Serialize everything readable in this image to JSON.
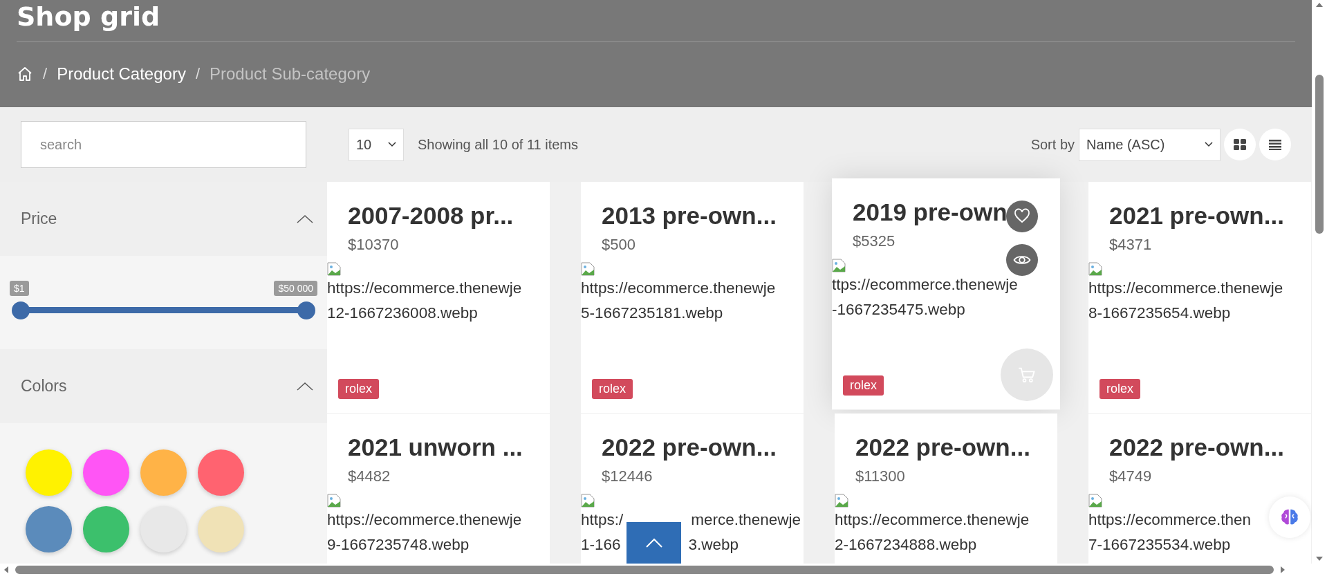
{
  "page_title": "Shop grid",
  "breadcrumb": [
    {
      "separator": "/",
      "label": "Product Category",
      "current": false
    },
    {
      "separator": "/",
      "label": "Product Sub-category",
      "current": true
    }
  ],
  "toolbar": {
    "search": {
      "placeholder": "search"
    },
    "per_page": "10",
    "result_count": "Showing all 10 of 11 items",
    "sort_label": "Sort by",
    "sort_value": "Name (ASC)",
    "views": [
      {
        "kind": "grid"
      },
      {
        "kind": "list"
      }
    ]
  },
  "filters": [
    {
      "kind": "price",
      "title": "Price",
      "expanded": true,
      "thumbs": [
        {
          "label": "$1",
          "level": 0
        },
        {
          "label": "$50 000",
          "level": 1
        }
      ]
    },
    {
      "kind": "colors",
      "title": "Colors",
      "expanded": true,
      "swatches": [
        {
          "color": "#fff200"
        },
        {
          "color": "#ff55f5"
        },
        {
          "color": "#ffb347"
        },
        {
          "color": "#ff6370"
        },
        {
          "color": "#5b8bbb"
        },
        {
          "color": "#3cc06c"
        },
        {
          "color": "#e8e8e8"
        },
        {
          "color": "#f0e2b6"
        }
      ]
    }
  ],
  "products": [
    {
      "title": "2007-2008 pr...",
      "price": "$10370",
      "image_text": [
        [
          "https://ecommerce.thenewje"
        ],
        [
          "12-1667236008.webp"
        ]
      ],
      "tag": "rolex",
      "hovered": false
    },
    {
      "title": "2013 pre-own...",
      "price": "$500",
      "image_text": [
        [
          "https://ecommerce.thenewje"
        ],
        [
          "5-1667235181.webp"
        ]
      ],
      "tag": "rolex",
      "hovered": false
    },
    {
      "title": "2019 pre-own",
      "price": "$5325",
      "image_text": [
        [
          "ttps://ecommerce.thenewje"
        ],
        [
          "-1667235475.webp"
        ]
      ],
      "tag": "rolex",
      "hovered": true
    },
    {
      "title": "2021 pre-own...",
      "price": "$4371",
      "image_text": [
        [
          "https://ecommerce.thenewje"
        ],
        [
          "8-1667235654.webp"
        ]
      ],
      "tag": "rolex",
      "hovered": false
    },
    {
      "title": "2021 unworn ...",
      "price": "$4482",
      "image_text": [
        [
          "https://ecommerce.thenewje"
        ],
        [
          "9-1667235748.webp"
        ]
      ],
      "hovered": false
    },
    {
      "title": "2022 pre-own...",
      "price": "$12446",
      "image_text": [
        [
          "https:/",
          "merce.thenewje"
        ],
        [
          "1-166",
          "3.webp"
        ]
      ],
      "hovered": false
    },
    {
      "title": "2022 pre-own...",
      "price": "$11300",
      "image_text": [
        [
          "https://ecommerce.thenewje"
        ],
        [
          "2-1667234888.webp"
        ]
      ],
      "hovered": false
    },
    {
      "title": "2022 pre-own...",
      "price": "$4749",
      "image_text": [
        [
          "https://ecommerce.then"
        ],
        [
          "7-1667235534.webp"
        ]
      ],
      "hovered": false
    }
  ]
}
